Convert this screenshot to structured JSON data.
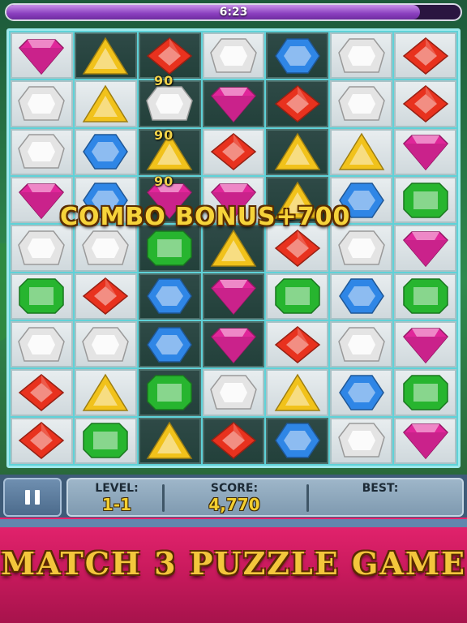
{
  "timer": {
    "text": "6:23",
    "remaining_fraction": 0.91
  },
  "board": {
    "columns": 7,
    "rows": [
      [
        "pink",
        "yellow",
        "red",
        "white",
        "blue",
        "white",
        "red"
      ],
      [
        "white",
        "yellow",
        "white",
        "pink",
        "red",
        "white",
        "red"
      ],
      [
        "white",
        "blue",
        "yellow",
        "red",
        "yellow",
        "yellow",
        "pink"
      ],
      [
        "pink",
        "blue",
        "pink",
        "pink",
        "yellow",
        "blue",
        "green"
      ],
      [
        "white",
        "white",
        "green",
        "yellow",
        "red",
        "white",
        "pink"
      ],
      [
        "green",
        "red",
        "blue",
        "pink",
        "green",
        "blue",
        "green"
      ],
      [
        "white",
        "white",
        "blue",
        "pink",
        "red",
        "white",
        "pink"
      ],
      [
        "red",
        "yellow",
        "green",
        "white",
        "yellow",
        "blue",
        "green"
      ],
      [
        "red",
        "green",
        "yellow",
        "red",
        "blue",
        "white",
        "pink"
      ]
    ],
    "dark_cells": [
      [
        0,
        1
      ],
      [
        0,
        2
      ],
      [
        0,
        4
      ],
      [
        1,
        2
      ],
      [
        1,
        3
      ],
      [
        1,
        4
      ],
      [
        2,
        2
      ],
      [
        2,
        4
      ],
      [
        3,
        2
      ],
      [
        3,
        4
      ],
      [
        4,
        2
      ],
      [
        4,
        3
      ],
      [
        5,
        2
      ],
      [
        5,
        3
      ],
      [
        6,
        2
      ],
      [
        6,
        3
      ],
      [
        7,
        2
      ],
      [
        8,
        2
      ],
      [
        8,
        3
      ],
      [
        8,
        4
      ]
    ]
  },
  "floating_points": [
    "90",
    "90",
    "90"
  ],
  "combo_text": "COMBO BONUS+700",
  "status": {
    "level_label": "LEVEL:",
    "level_value": "1-1",
    "score_label": "SCORE:",
    "score_value": "4,770",
    "best_label": "BEST:",
    "best_value": ""
  },
  "banner_text": "MATCH 3 PUZZLE GAME",
  "gem_colors": {
    "red": "#e8321e",
    "pink": "#e0269a",
    "yellow": "#f1c21b",
    "white": "#e4e4e4",
    "blue": "#2f86e6",
    "green": "#27b52f"
  }
}
